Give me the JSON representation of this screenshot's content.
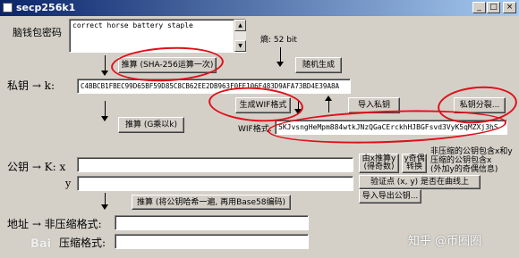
{
  "window": {
    "title": "secp256k1",
    "minimize": "_",
    "maximize": "□",
    "close": "×"
  },
  "brainwallet": {
    "label": "脑钱包密码",
    "value": "correct horse battery staple"
  },
  "entropy": {
    "label": "熵: 52 bit"
  },
  "buttons": {
    "sha256": "推算 (SHA-256运算一次)",
    "random": "随机生成",
    "gen_wif": "生成WIF格式",
    "import_key": "导入私钥",
    "split_key": "私钥分裂...",
    "derive_pub": "推算 (G乘以k)",
    "derive_y": "由x推算y (得奇数)",
    "parity": "y奇偶转换",
    "verify": "验证点 (x, y) 是否在曲线上",
    "import_export_pub": "导入导出公钥...",
    "derive_addr": "推算 (将公钥哈希一遍, 再用Base58编码)"
  },
  "privkey": {
    "label": "私钥 → k:",
    "value": "C4BBCB1FBEC99D65BF59D85C8CB62EE2DB963F0FE106F483D9AFA73BD4E39A8A"
  },
  "wif": {
    "label": "WIF格式:",
    "value": "5KJvsngHeMpm884wtkJNzQGaCErckhHJBGFsvd3VyK5qMZXj3hS"
  },
  "pubkey": {
    "label": "公钥 → K: x",
    "y_label": "y",
    "x_value": "",
    "y_value": ""
  },
  "notes": {
    "line1": "非压缩的公钥包含x和y",
    "line2": "压缩的公钥包含x",
    "line3": "(外加y的奇偶信息)"
  },
  "address": {
    "label": "地址 → 非压缩格式:",
    "compressed_label": "压缩格式:",
    "uncompressed_value": "",
    "compressed_value": ""
  },
  "watermarks": {
    "left": "Bai",
    "right": "知乎 @币圈圈"
  },
  "colors": {
    "annotation": "#e0101a",
    "titlebar": "#0a246a"
  }
}
